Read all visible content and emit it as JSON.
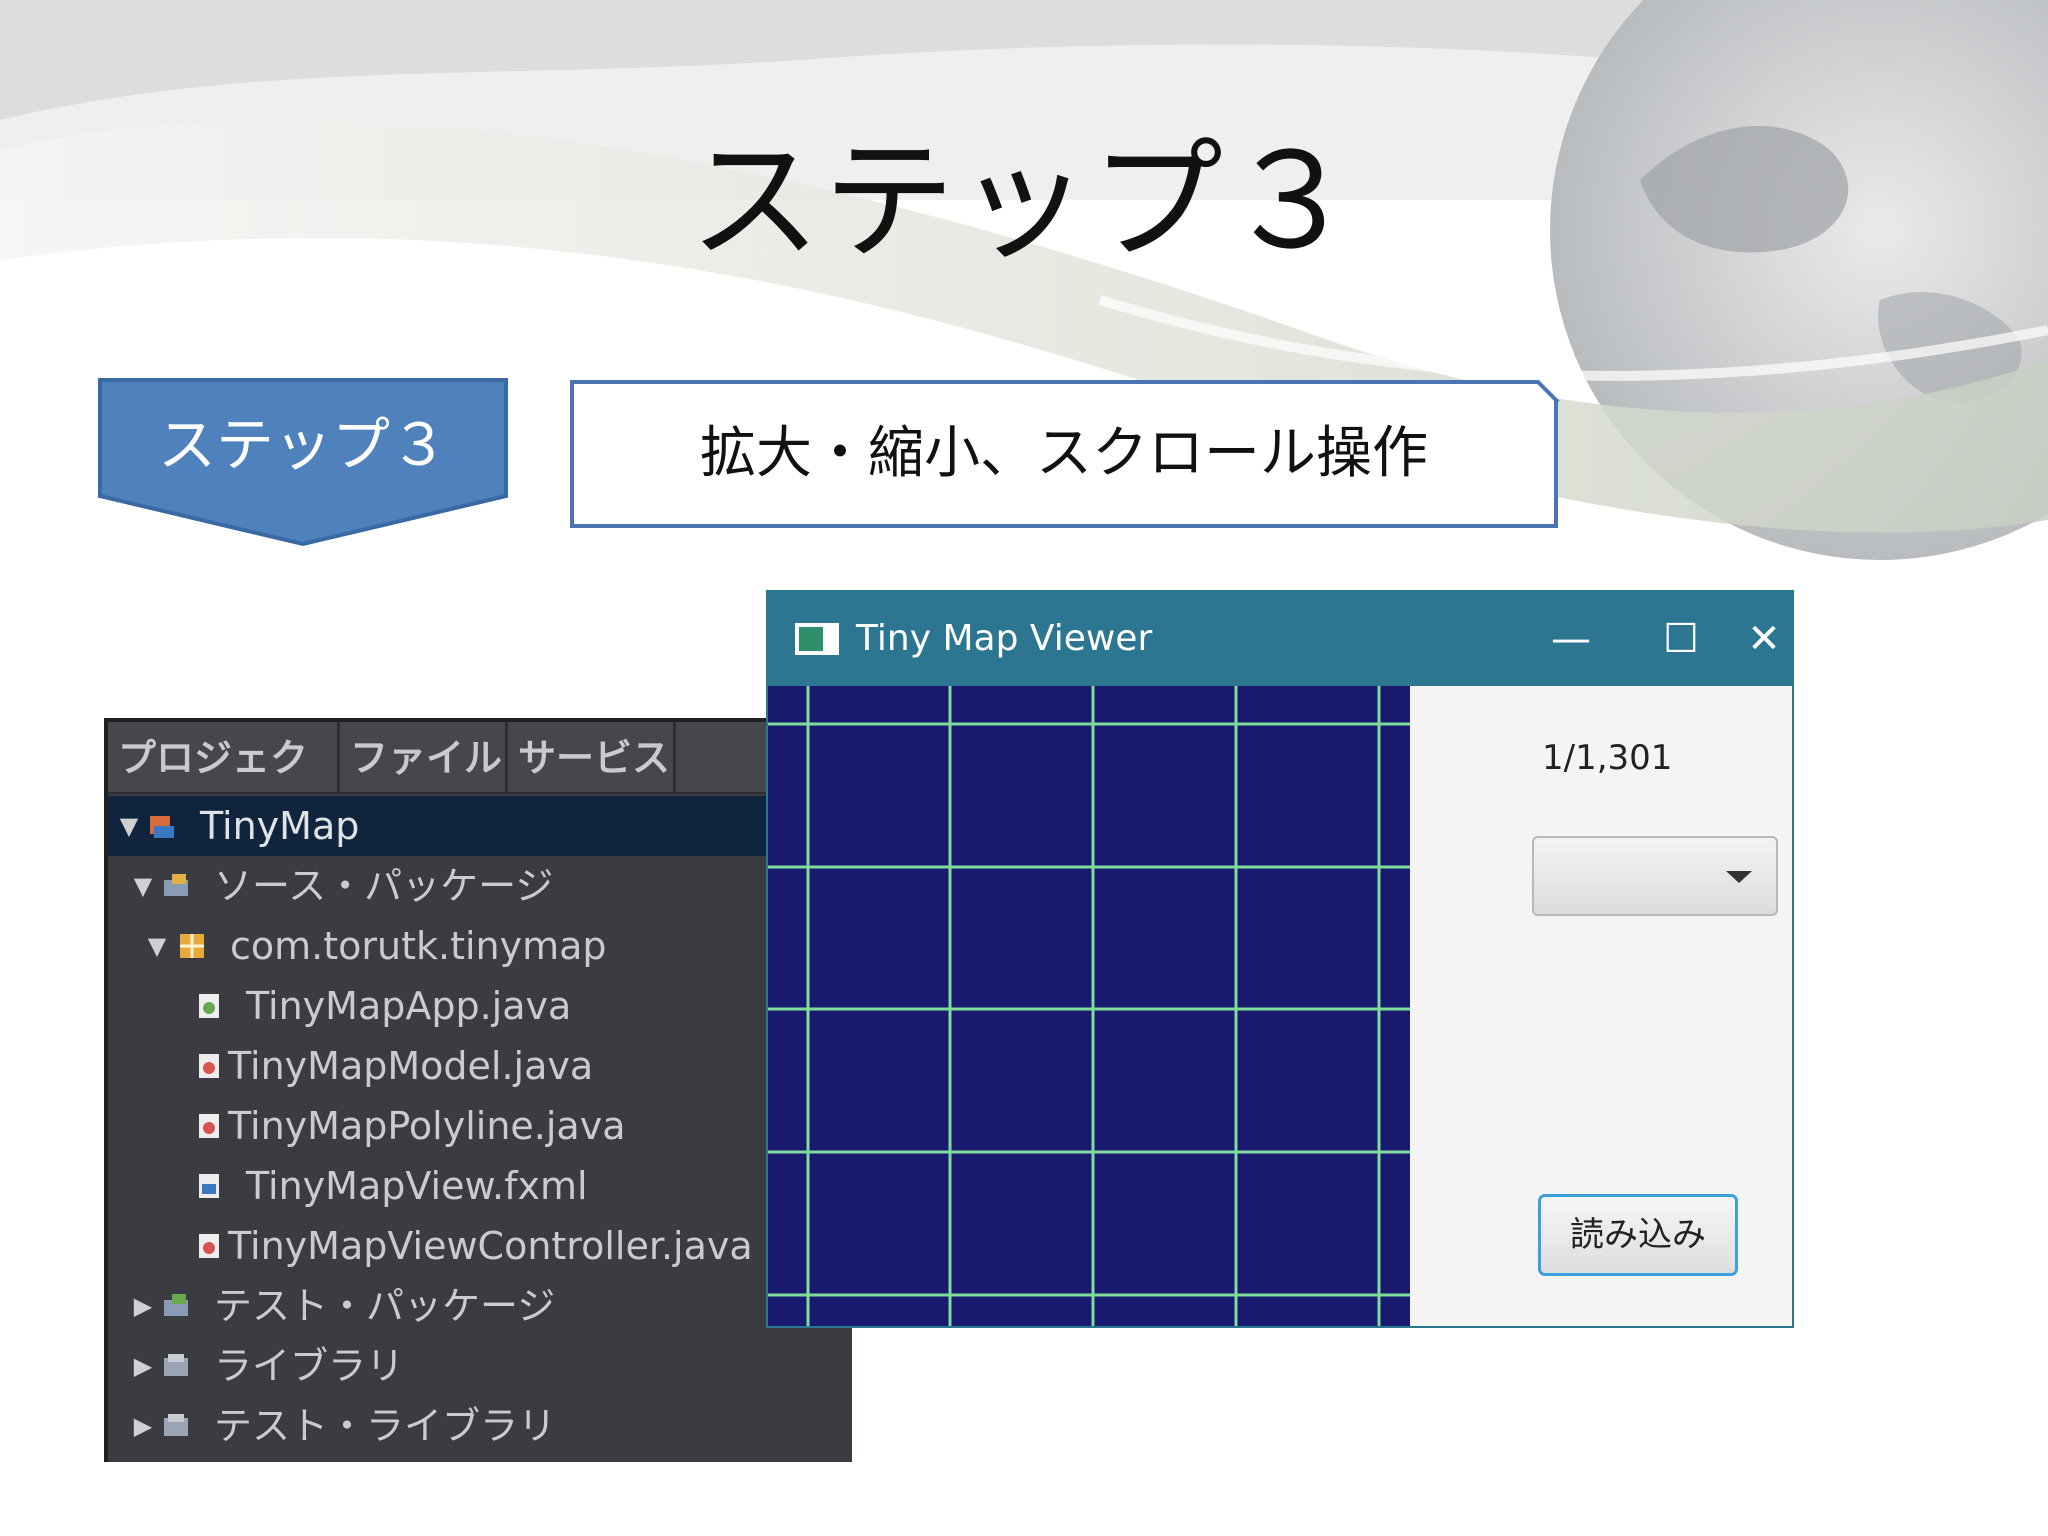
{
  "slide": {
    "title": "ステップ３",
    "step_badge": "ステップ３",
    "description": "拡大・縮小、スクロール操作"
  },
  "colors": {
    "badge_fill": "#4f81bd",
    "desc_border": "#4a74b4",
    "titlebar": "#2d7691",
    "map_background": "#191970",
    "grid_line": "#7fdc9a"
  },
  "ide": {
    "tabs": [
      {
        "label": "プロジェクト",
        "close": "×"
      },
      {
        "label": "ファイル"
      },
      {
        "label": "サービス"
      }
    ],
    "tree": [
      {
        "label": "TinyMap",
        "twisty": "▼",
        "icon": "javafx-project-icon",
        "selected": true
      },
      {
        "label": "ソース・パッケージ",
        "twisty": "▼",
        "icon": "source-packages-icon"
      },
      {
        "label": "com.torutk.tinymap",
        "twisty": "▼",
        "icon": "package-icon"
      },
      {
        "label": "TinyMapApp.java",
        "icon": "java-main-class-icon"
      },
      {
        "label": "TinyMapModel.java",
        "icon": "java-class-icon"
      },
      {
        "label": "TinyMapPolyline.java",
        "icon": "java-class-icon"
      },
      {
        "label": "TinyMapView.fxml",
        "icon": "fxml-file-icon"
      },
      {
        "label": "TinyMapViewController.java",
        "icon": "java-class-icon"
      },
      {
        "label": "テスト・パッケージ",
        "twisty": "▶",
        "icon": "test-packages-icon"
      },
      {
        "label": "ライブラリ",
        "twisty": "▶",
        "icon": "libraries-icon"
      },
      {
        "label": "テスト・ライブラリ",
        "twisty": "▶",
        "icon": "test-libraries-icon"
      }
    ]
  },
  "app": {
    "title": "Tiny Map Viewer",
    "minimize": "—",
    "maximize": "☐",
    "close": "✕",
    "page_indicator": "1/1,301",
    "combo_value": "",
    "load_button": "読み込み"
  }
}
